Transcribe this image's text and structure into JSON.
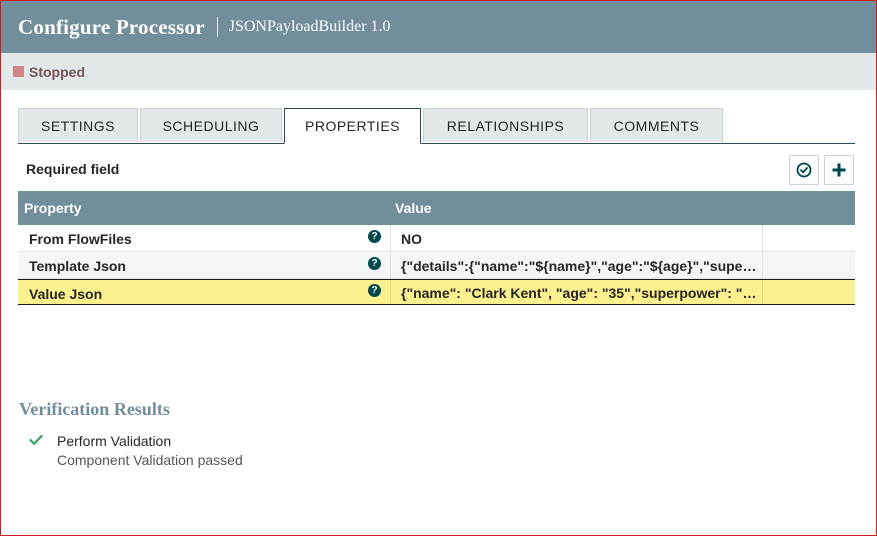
{
  "header": {
    "title": "Configure Processor",
    "subtitle": "JSONPayloadBuilder 1.0"
  },
  "status": {
    "label": "Stopped",
    "color": "#d18686"
  },
  "tabs": [
    {
      "label": "SETTINGS"
    },
    {
      "label": "SCHEDULING"
    },
    {
      "label": "PROPERTIES",
      "active": true
    },
    {
      "label": "RELATIONSHIPS"
    },
    {
      "label": "COMMENTS"
    }
  ],
  "properties": {
    "required_label": "Required field",
    "columns": {
      "property": "Property",
      "value": "Value"
    },
    "rows": [
      {
        "name": "From FlowFiles",
        "value": "NO"
      },
      {
        "name": "Template Json",
        "value": "{\"details\":{\"name\":\"${name}\",\"age\":\"${age}\",\"superpower\":\"${superpower}\"}}"
      },
      {
        "name": "Value Json",
        "value": "{\"name\": \"Clark Kent\", \"age\": \"35\",\"superpower\": \"Super strength\"}"
      }
    ]
  },
  "verification": {
    "title": "Verification Results",
    "items": [
      {
        "name": "Perform Validation",
        "detail": "Component Validation passed"
      }
    ]
  },
  "colors": {
    "header_bg": "#728e9b",
    "accent": "#004849",
    "selected_row": "#fdf18f",
    "success": "#3ea674"
  }
}
